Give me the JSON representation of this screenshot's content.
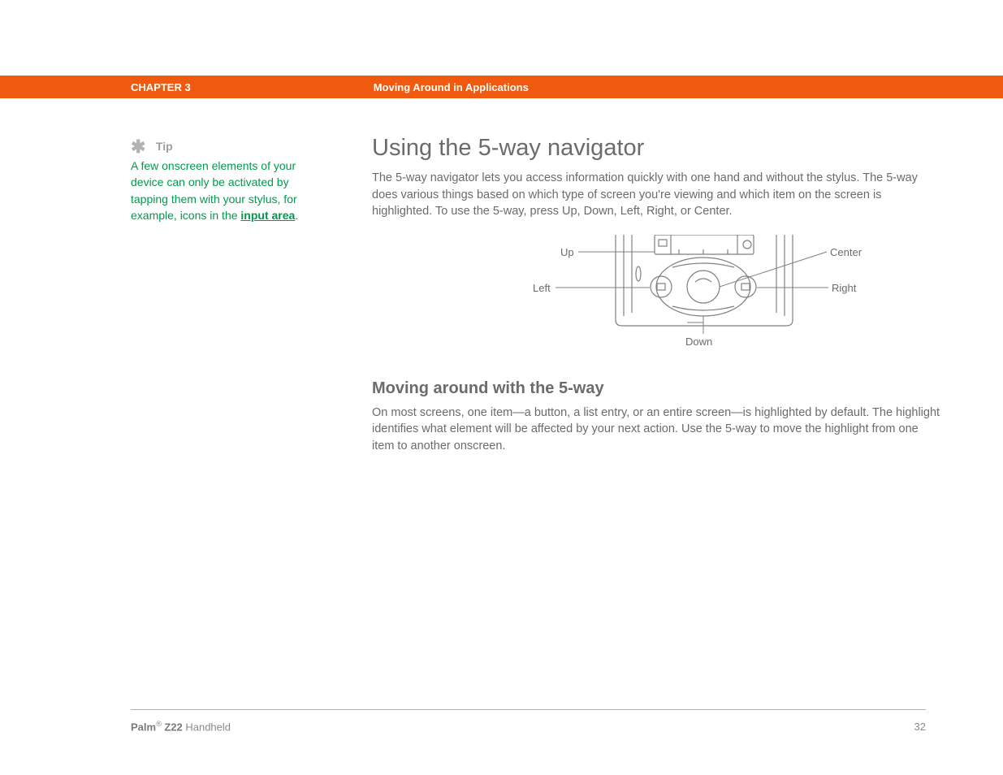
{
  "header": {
    "chapter": "CHAPTER 3",
    "breadcrumb": "Moving Around in Applications"
  },
  "tip": {
    "label": "Tip",
    "body_before": "A few onscreen elements of your device can only be activated by tapping them with your stylus, for example, icons in the ",
    "link": "input area",
    "body_after": "."
  },
  "main": {
    "h1": "Using the 5-way navigator",
    "p1": "The 5-way navigator lets you access information quickly with one hand and without the stylus. The 5-way does various things based on which type of screen you're viewing and which item on the screen is highlighted. To use the 5-way, press Up, Down, Left, Right, or Center.",
    "h2": "Moving around with the 5-way",
    "p2": "On most screens, one item—a button, a list entry, or an entire screen—is highlighted by default. The highlight identifies what element will be affected by your next action. Use the 5-way to move the highlight from one item to another onscreen."
  },
  "diagram": {
    "up": "Up",
    "down": "Down",
    "left": "Left",
    "right": "Right",
    "center": "Center"
  },
  "footer": {
    "brand": "Palm",
    "reg": "®",
    "model": " Z22",
    "suffix": " Handheld",
    "page": "32"
  }
}
